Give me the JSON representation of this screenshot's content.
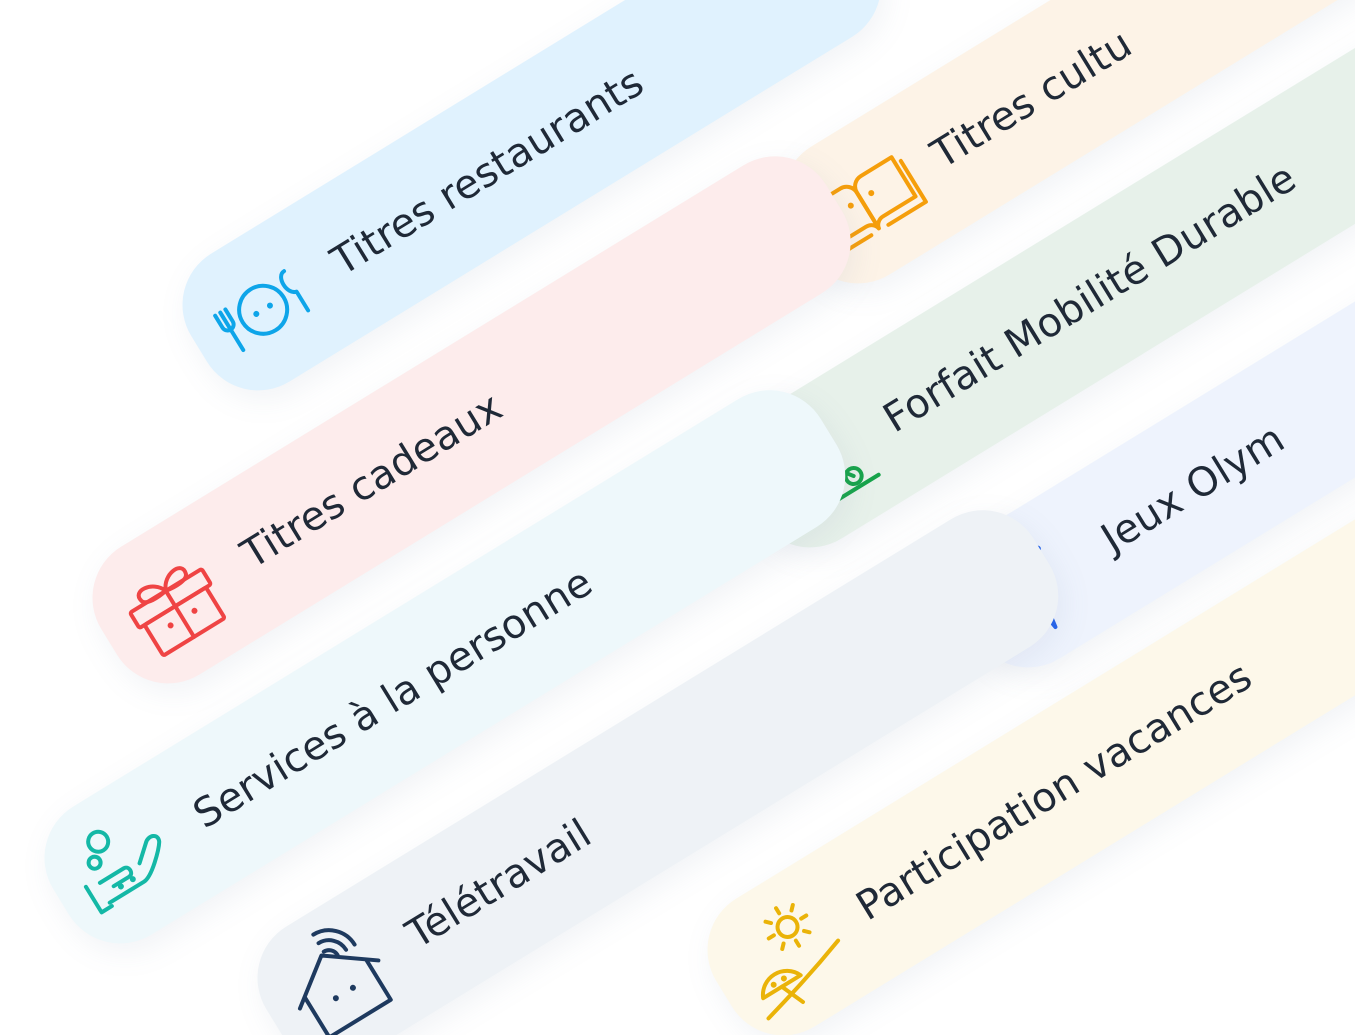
{
  "cards": [
    {
      "label": "Titres restaurants",
      "icon": "plate-cutlery-icon",
      "bg": "#e0f2fe",
      "accent": "#0ea5e9"
    },
    {
      "label": "Titres cultu",
      "icon": "open-book-icon",
      "bg": "#fdf3e7",
      "accent": "#f59e0b"
    },
    {
      "label": "Titres cadeaux",
      "icon": "gift-icon",
      "bg": "#fdecec",
      "accent": "#ef4444"
    },
    {
      "label": "Forfait Mobilité Durable",
      "icon": "scooter-icon",
      "bg": "#e7f1ea",
      "accent": "#16a34a"
    },
    {
      "label": "Services à la personne",
      "icon": "caring-hand-icon",
      "bg": "#eef8fb",
      "accent": "#14b8a6"
    },
    {
      "label": "Jeux Olym",
      "icon": "torch-icon",
      "bg": "#eef3fd",
      "accent": "#2563eb"
    },
    {
      "label": "Télétravail",
      "icon": "wifi-house-icon",
      "bg": "#eef2f6",
      "accent": "#1e3a5f"
    },
    {
      "label": "Participation vacances",
      "icon": "beach-umbrella-icon",
      "bg": "#fdf8ea",
      "accent": "#eab308"
    }
  ]
}
